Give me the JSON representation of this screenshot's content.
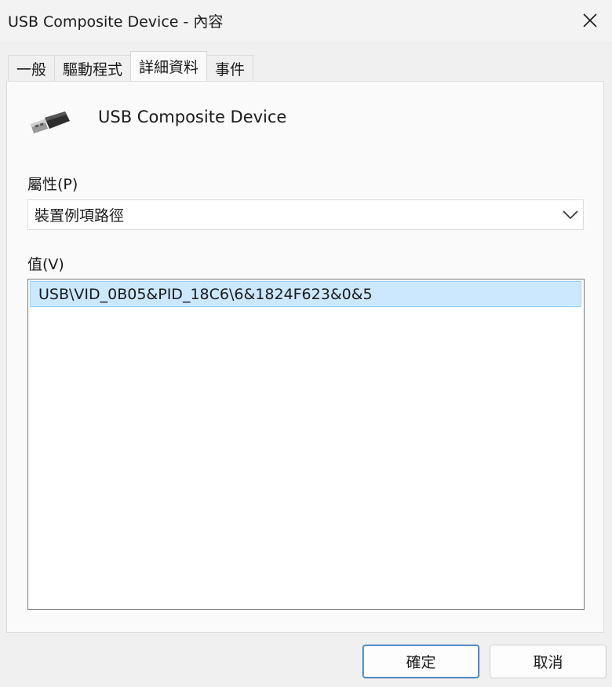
{
  "window": {
    "title": "USB Composite Device - 內容",
    "close_icon": "close-icon"
  },
  "tabs": [
    {
      "label": "一般",
      "active": false
    },
    {
      "label": "驅動程式",
      "active": false
    },
    {
      "label": "詳細資料",
      "active": true
    },
    {
      "label": "事件",
      "active": false
    }
  ],
  "device": {
    "icon": "usb-connector-icon",
    "name": "USB Composite Device"
  },
  "property": {
    "label": "屬性(P)",
    "selected": "裝置例項路徑"
  },
  "value": {
    "label": "值(V)",
    "items": [
      "USB\\VID_0B05&PID_18C6\\6&1824F623&0&5"
    ]
  },
  "buttons": {
    "ok": "確定",
    "cancel": "取消"
  }
}
